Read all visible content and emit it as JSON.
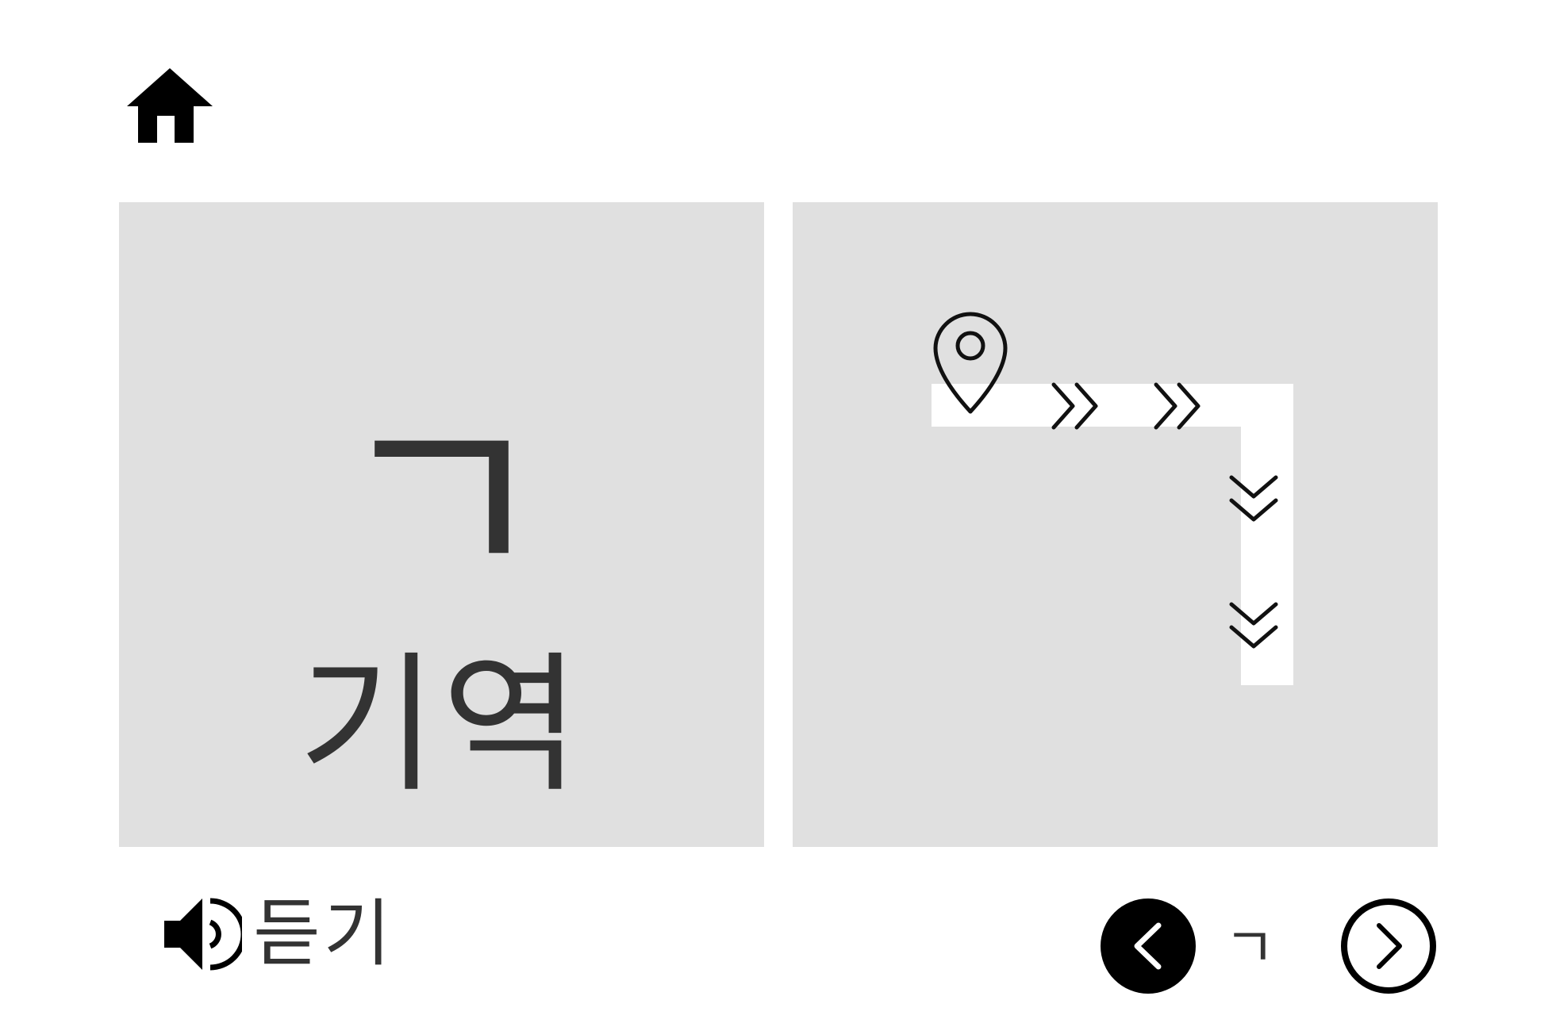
{
  "letter": {
    "symbol": "ㄱ",
    "name": "기역"
  },
  "stroke_guide": {
    "start_marker": "location-pin-icon",
    "direction_marks": [
      "double-chevron-right",
      "double-chevron-right",
      "double-chevron-down",
      "double-chevron-down"
    ]
  },
  "controls": {
    "listen_label": "듣기",
    "current_letter": "ㄱ",
    "home_icon": "home-icon",
    "speaker_icon": "speaker-icon",
    "prev_icon": "chevron-left-circle-filled-icon",
    "next_icon": "chevron-right-circle-outline-icon"
  },
  "colors": {
    "panel_bg": "#e0e0e0",
    "text": "#333333",
    "stroke_path": "#ffffff",
    "icon": "#000000"
  }
}
